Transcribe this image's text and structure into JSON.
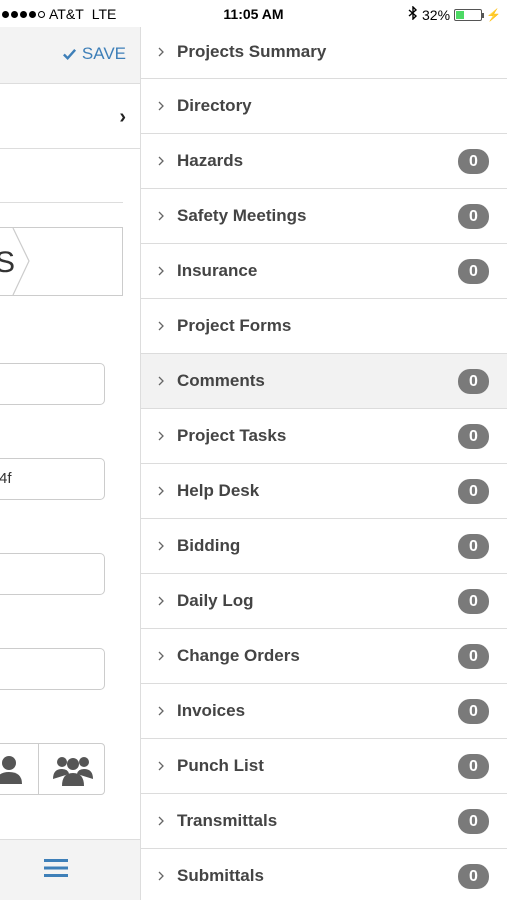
{
  "status_bar": {
    "carrier": "AT&T",
    "network": "LTE",
    "time": "11:05 AM",
    "battery_text": "32%",
    "battery_level": 0.32
  },
  "left_pane": {
    "save_label": "SAVE",
    "breadcrumb_partial": "S",
    "field_values": [
      "",
      "4f",
      "",
      ""
    ]
  },
  "menu": {
    "items": [
      {
        "label": "Projects Summary",
        "badge": null
      },
      {
        "label": "Directory",
        "badge": null
      },
      {
        "label": "Hazards",
        "badge": "0"
      },
      {
        "label": "Safety Meetings",
        "badge": "0"
      },
      {
        "label": "Insurance",
        "badge": "0"
      },
      {
        "label": "Project Forms",
        "badge": null
      },
      {
        "label": "Comments",
        "badge": "0",
        "active": true
      },
      {
        "label": "Project Tasks",
        "badge": "0"
      },
      {
        "label": "Help Desk",
        "badge": "0"
      },
      {
        "label": "Bidding",
        "badge": "0"
      },
      {
        "label": "Daily Log",
        "badge": "0"
      },
      {
        "label": "Change Orders",
        "badge": "0"
      },
      {
        "label": "Invoices",
        "badge": "0"
      },
      {
        "label": "Punch List",
        "badge": "0"
      },
      {
        "label": "Transmittals",
        "badge": "0"
      },
      {
        "label": "Submittals",
        "badge": "0"
      }
    ]
  },
  "colors": {
    "accent": "#3e7fb8",
    "badge": "#7a7a7a",
    "battery": "#4cd964"
  }
}
